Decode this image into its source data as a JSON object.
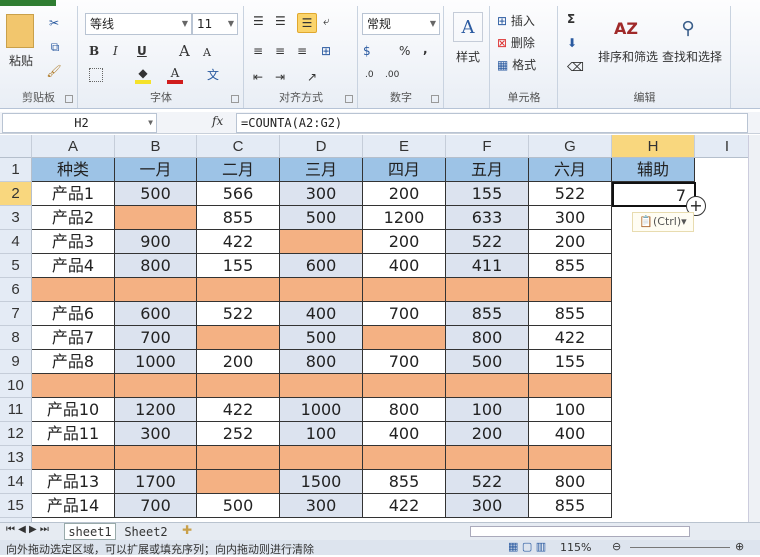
{
  "ribbon": {
    "clipboard": {
      "label": "剪贴板",
      "paste": "粘贴"
    },
    "font": {
      "label": "字体",
      "name": "等线",
      "size": "11",
      "bold": "B",
      "italic": "I",
      "underline": "U",
      "grow": "A",
      "shrink": "A",
      "phonetic": "文"
    },
    "alignment": {
      "label": "对齐方式"
    },
    "number": {
      "label": "数字",
      "format": "常规",
      "percent": "%",
      "comma": ","
    },
    "styles": {
      "label": "样式"
    },
    "cells": {
      "label": "单元格",
      "insert": "插入",
      "delete": "删除",
      "format": "格式"
    },
    "editing": {
      "label": "编辑",
      "sum": "Σ",
      "sort_filter": "排序和筛选",
      "find_select": "查找和选择"
    }
  },
  "formula_bar": {
    "name_box": "H2",
    "fx": "fx",
    "formula": "=COUNTA(A2:G2)"
  },
  "columns": [
    "A",
    "B",
    "C",
    "D",
    "E",
    "F",
    "G",
    "H",
    "I"
  ],
  "header_row": [
    "种类",
    "一月",
    "二月",
    "三月",
    "四月",
    "五月",
    "六月",
    "辅助"
  ],
  "rows": [
    [
      "产品1",
      "500",
      "566",
      "300",
      "200",
      "155",
      "522"
    ],
    [
      "产品2",
      "",
      "855",
      "500",
      "1200",
      "633",
      "300"
    ],
    [
      "产品3",
      "900",
      "422",
      "",
      "200",
      "522",
      "200"
    ],
    [
      "产品4",
      "800",
      "155",
      "600",
      "400",
      "411",
      "855"
    ],
    [
      "",
      "",
      "",
      "",
      "",
      "",
      ""
    ],
    [
      "产品6",
      "600",
      "522",
      "400",
      "700",
      "855",
      "855"
    ],
    [
      "产品7",
      "700",
      "",
      "500",
      "",
      "800",
      "422"
    ],
    [
      "产品8",
      "1000",
      "200",
      "800",
      "700",
      "500",
      "155"
    ],
    [
      "",
      "",
      "",
      "",
      "",
      "",
      ""
    ],
    [
      "产品10",
      "1200",
      "422",
      "1000",
      "800",
      "100",
      "100"
    ],
    [
      "产品11",
      "300",
      "252",
      "100",
      "400",
      "200",
      "400"
    ],
    [
      "",
      "",
      "",
      "",
      "",
      "",
      ""
    ],
    [
      "产品13",
      "1700",
      "",
      "1500",
      "855",
      "522",
      "800"
    ],
    [
      "产品14",
      "700",
      "500",
      "300",
      "422",
      "300",
      "855"
    ]
  ],
  "h2_value": "7",
  "paste_options": "(Ctrl)",
  "sheets": [
    "sheet1",
    "Sheet2"
  ],
  "status": {
    "message": "向外拖动选定区域，可以扩展或填充序列；向内拖动则进行清除",
    "zoom": "115%"
  },
  "colors": {
    "header_fill": "#9dc3e6",
    "blank_fill": "#f4b183",
    "alt_fill": "#dce3ef",
    "selected_header": "#f9d77e"
  }
}
